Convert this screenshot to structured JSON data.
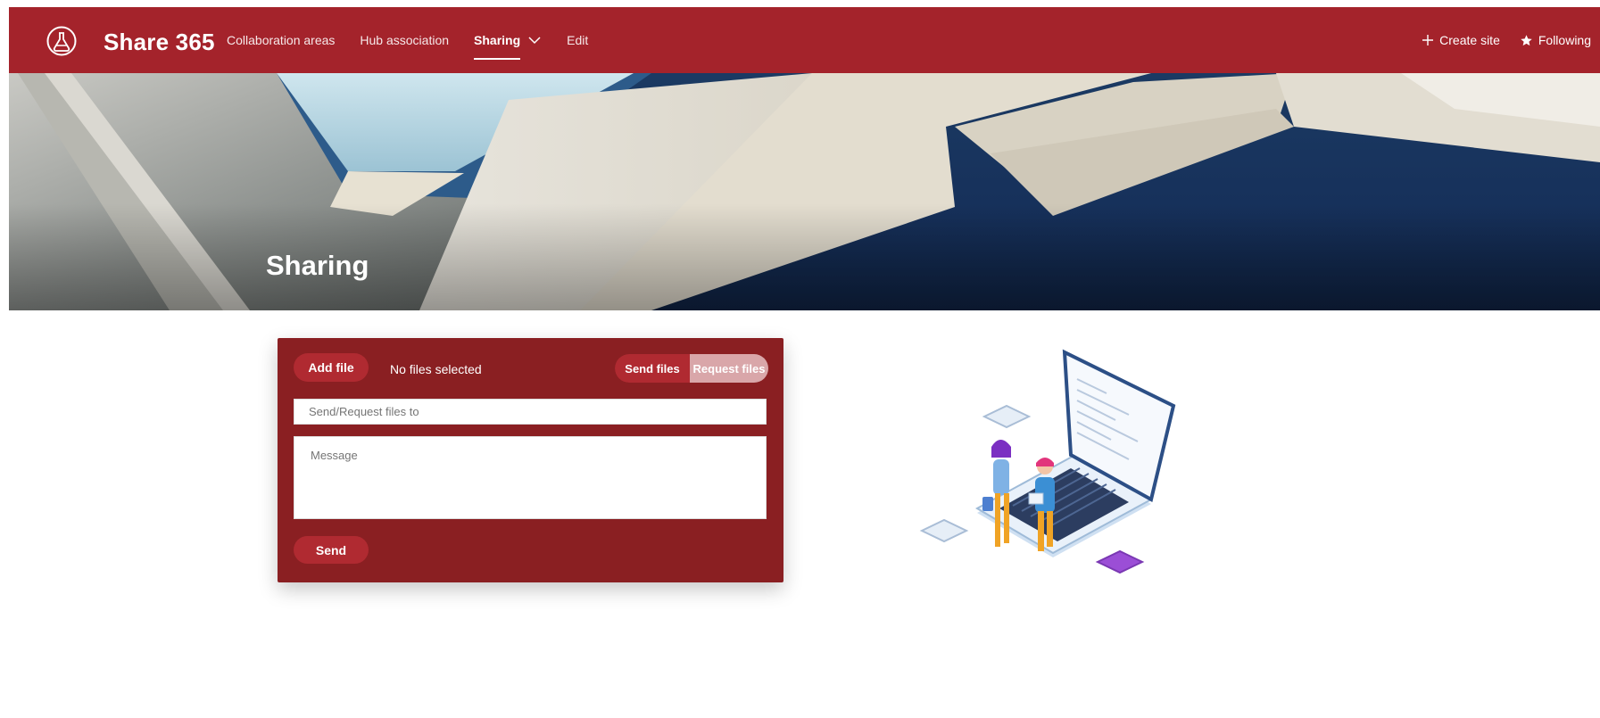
{
  "app": {
    "name": "Share 365",
    "logo_icon": "flask-logo-icon"
  },
  "nav": {
    "items": [
      {
        "label": "Collaboration areas",
        "active": false
      },
      {
        "label": "Hub association",
        "active": false
      },
      {
        "label": "Sharing",
        "active": true,
        "has_dropdown": true
      },
      {
        "label": "Edit",
        "active": false
      }
    ]
  },
  "actions": {
    "create_site": {
      "icon": "plus-icon",
      "label": "Create site"
    },
    "following": {
      "icon": "star-icon",
      "label": "Following"
    }
  },
  "hero": {
    "title": "Sharing"
  },
  "form": {
    "add_file_label": "Add file",
    "file_status": "No files selected",
    "mode_toggle": {
      "send": "Send files",
      "request": "Request files",
      "selected": "Send files"
    },
    "to_placeholder": "Send/Request files to",
    "message_placeholder": "Message",
    "send_label": "Send"
  },
  "colors": {
    "brand": "#a4232b",
    "card": "#8a1f22",
    "button": "#b02a31",
    "toggle_inactive": "#d9a6a9"
  }
}
